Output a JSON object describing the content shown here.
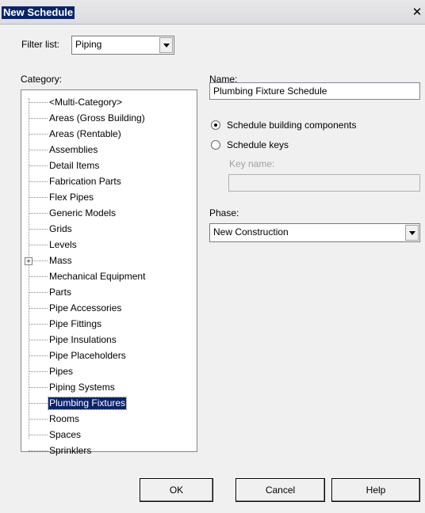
{
  "window": {
    "title": "New Schedule",
    "close_glyph": "✕"
  },
  "filter": {
    "label": "Filter list:",
    "value": "Piping"
  },
  "category": {
    "label": "Category:",
    "items": [
      "<Multi-Category>",
      "Areas (Gross Building)",
      "Areas (Rentable)",
      "Assemblies",
      "Detail Items",
      "Fabrication Parts",
      "Flex Pipes",
      "Generic Models",
      "Grids",
      "Levels",
      "Mass",
      "Mechanical Equipment",
      "Parts",
      "Pipe Accessories",
      "Pipe Fittings",
      "Pipe Insulations",
      "Pipe Placeholders",
      "Pipes",
      "Piping Systems",
      "Plumbing Fixtures",
      "Rooms",
      "Spaces",
      "Sprinklers"
    ],
    "selected": "Plumbing Fixtures",
    "expandable": "Mass"
  },
  "name": {
    "label": "Name:",
    "value": "Plumbing Fixture Schedule"
  },
  "options": {
    "building_components": "Schedule building components",
    "keys": "Schedule keys",
    "selected": "building_components"
  },
  "key_name": {
    "label": "Key name:",
    "value": ""
  },
  "phase": {
    "label": "Phase:",
    "value": "New Construction"
  },
  "buttons": {
    "ok": "OK",
    "cancel": "Cancel",
    "help": "Help"
  },
  "colors": {
    "selection": "#0a246a",
    "title_highlight": "#0a246a",
    "disabled_text": "#a0a0a0"
  }
}
